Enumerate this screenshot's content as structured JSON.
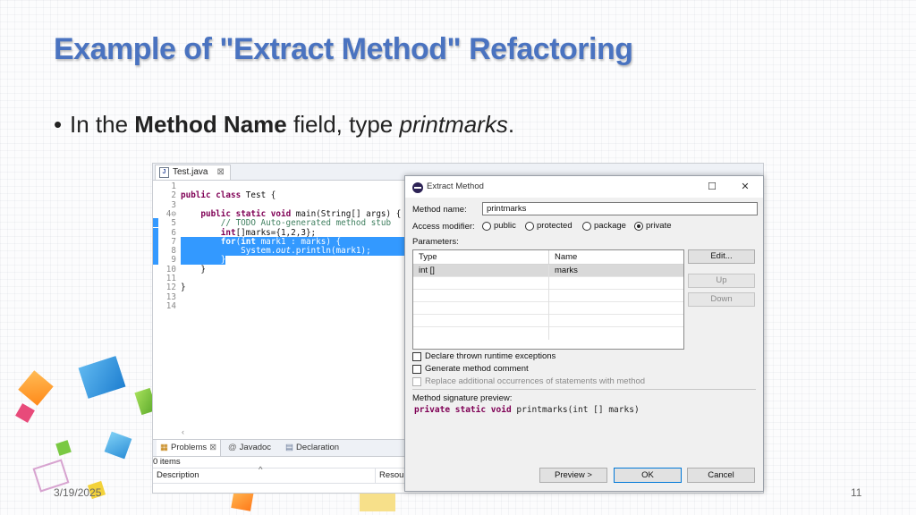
{
  "slide": {
    "title": "Example of \"Extract Method\" Refactoring",
    "bullet": {
      "prefix": "In the ",
      "bold": "Method Name",
      "middle": " field, type ",
      "italic": "printmarks",
      "suffix": "."
    },
    "date": "3/19/2025",
    "page_number": "11"
  },
  "editor": {
    "tab_label": "Test.java",
    "tab_close": "⊠",
    "lines": [
      {
        "n": "1",
        "t": ""
      },
      {
        "n": "2",
        "t": "public class Test {"
      },
      {
        "n": "3",
        "t": ""
      },
      {
        "n": "4⊖",
        "t": "    public static void main(String[] args) {"
      },
      {
        "n": "5",
        "t": "        // TODO Auto-generated method stub"
      },
      {
        "n": "6",
        "t": "        int[]marks={1,2,3};"
      },
      {
        "n": "7",
        "t": "        for(int mark1 : marks) {"
      },
      {
        "n": "8",
        "t": "            System.out.println(mark1);"
      },
      {
        "n": "9",
        "t": "        }"
      },
      {
        "n": "10",
        "t": "    }"
      },
      {
        "n": "11",
        "t": ""
      },
      {
        "n": "12",
        "t": "}"
      },
      {
        "n": "13",
        "t": ""
      },
      {
        "n": "14",
        "t": ""
      }
    ],
    "scroll_arrow": "‹",
    "bottom_tabs": {
      "problems": "Problems",
      "problems_close": "⊠",
      "javadoc": "Javadoc",
      "declaration": "Declaration"
    },
    "items_count": "0 items",
    "col_description": "Description",
    "col_resource": "Resou"
  },
  "dialog": {
    "title": "Extract Method",
    "method_name_label": "Method name:",
    "method_name_value": "printmarks",
    "access_modifier_label": "Access modifier:",
    "access_options": [
      "public",
      "protected",
      "package",
      "private"
    ],
    "access_selected": "private",
    "parameters_label": "Parameters:",
    "param_cols": [
      "Type",
      "Name"
    ],
    "param_rows": [
      {
        "type": "int []",
        "name": "marks"
      }
    ],
    "edit_button": "Edit...",
    "up_button": "Up",
    "down_button": "Down",
    "declare_exceptions": "Declare thrown runtime exceptions",
    "generate_comment": "Generate method comment",
    "replace_occurrences": "Replace additional occurrences of statements with method",
    "signature_label": "Method signature preview:",
    "signature_kw": "private static void",
    "signature_rest": " printmarks(int [] marks)",
    "preview_button": "Preview >",
    "ok_button": "OK",
    "cancel_button": "Cancel"
  },
  "colors": {
    "title": "#4a73c0",
    "selection": "#3399ff",
    "keyword": "#7f0055",
    "comment": "#3f7f5f"
  }
}
